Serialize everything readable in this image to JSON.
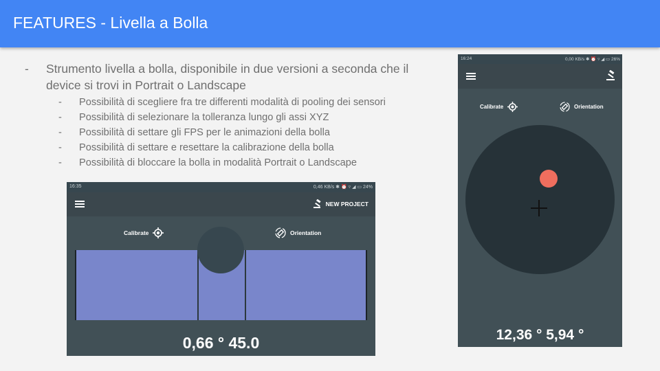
{
  "slide": {
    "title": "FEATURES - Livella a Bolla",
    "bullet_main": {
      "dash": "-",
      "line1": "Strumento livella a bolla, disponibile in due versioni a seconda che il",
      "line2": "device si trovi in Portrait o Landscape"
    },
    "sub_bullets": [
      "Possibilità di scegliere fra tre differenti modalità di pooling dei sensori",
      "Possibilità di selezionare la tolleranza lungo gli assi XYZ",
      "Possibilità di settare gli FPS per le animazioni della bolla",
      "Possibilità di settare e resettare la calibrazione della bolla",
      "Possibilità di bloccare la bolla in modalità Portrait o Landscape"
    ]
  },
  "landscape_screen": {
    "status_time": "16:35",
    "status_right": "0,46 KB/s  ✱ ⏰ ▿ ◢ ▭ 24%",
    "new_project_label": "NEW PROJECT",
    "calibrate_label": "Calibrate",
    "orientation_label": "Orientation",
    "readout": "0,66 ° 45.0"
  },
  "portrait_screen": {
    "status_time": "16:24",
    "status_right": "0,00 KB/s ✱ ⏰ ▿ ◢ ▭ 26%",
    "calibrate_label": "Calibrate",
    "orientation_label": "Orientation",
    "readout": "12,36 ° 5,94 °"
  },
  "colors": {
    "title_bar": "#4285f4",
    "screen_bg": "#415056",
    "tube": "#7986cb",
    "disc": "#263238",
    "bubble": "#ef6e5e"
  }
}
